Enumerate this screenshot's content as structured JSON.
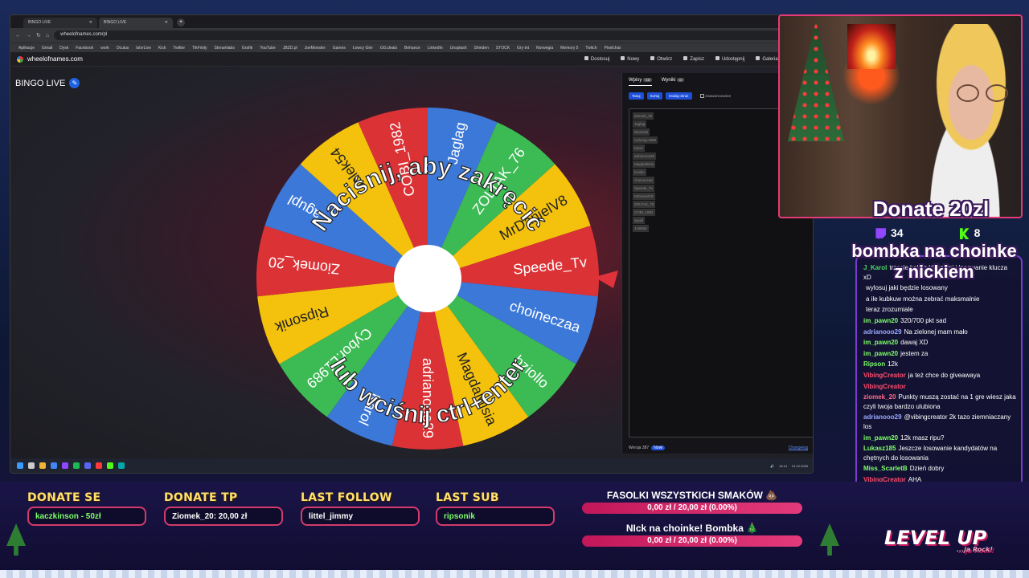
{
  "browser": {
    "tabs": [
      "BINGO LIVE",
      "BINGO LIVE"
    ],
    "url": "wheelofnames.com/pl",
    "bookmarks": [
      "Aplikacje",
      "Gmail",
      "Dysk",
      "Facebook",
      "work",
      "Oculus",
      "tstvrLive",
      "Kick",
      "Twitter",
      "TikFinity",
      "Streamlabs",
      "Grafik",
      "YouTube",
      "JBZD.pl",
      "JoeMonster",
      "Games",
      "Łowcy Gier",
      "GG.deals",
      "Behance",
      "LinkedIn",
      "Unsplash",
      "Shinden",
      "STOCK",
      "Gry tnt",
      "Norwegia",
      "Memory 5",
      "Twitch",
      "Pixelchat"
    ]
  },
  "app": {
    "site_name": "wheelofnames.com",
    "menu": [
      "Dostosuj",
      "Nowy",
      "Otwórz",
      "Zapisz",
      "Udostępnij",
      "Galeria",
      "Więc"
    ],
    "wheel_title": "BINGO LIVE",
    "pen_icon": "pencil-icon"
  },
  "wheel": {
    "segments": [
      {
        "label": "COBI_1982",
        "color": "#db3236"
      },
      {
        "label": "Jaglag",
        "color": "#3c78d8"
      },
      {
        "label": "ZOLTAK_76",
        "color": "#3cba54"
      },
      {
        "label": "MrDanielV8",
        "color": "#f4c20d"
      },
      {
        "label": "Speede_Tv",
        "color": "#db3236"
      },
      {
        "label": "choineczaa",
        "color": "#3c78d8"
      },
      {
        "label": "bziollo",
        "color": "#3cba54"
      },
      {
        "label": "MagdaMisia",
        "color": "#f4c20d"
      },
      {
        "label": "adrianooo29",
        "color": "#db3236"
      },
      {
        "label": "Karol",
        "color": "#3c78d8"
      },
      {
        "label": "Cybor.L1989",
        "color": "#3cba54"
      },
      {
        "label": "Ripsonik",
        "color": "#f4c20d"
      },
      {
        "label": "Ziomek_20",
        "color": "#db3236"
      },
      {
        "label": "agupl",
        "color": "#3c78d8"
      },
      {
        "label": "Jolek54",
        "color": "#f4c20d"
      }
    ],
    "overlay_top": "Naciśnij, aby zakręcić",
    "overlay_bottom": "lub wciśnij ctrl+enter"
  },
  "side": {
    "tab_entries": "Wpisy",
    "tab_entries_count": "15",
    "tab_results": "Wyniki",
    "tab_results_count": "0",
    "btn_shuffle": "Tasuj",
    "btn_sort": "Sortuj",
    "btn_add_image": "Dodaj obraz",
    "advanced": "Zaawansowane",
    "entries": [
      "Ziomek_20",
      "Jaglag",
      "Ripsonik",
      "CyborgL1989",
      "Karol",
      "adrianooo29",
      "MagdaMisia",
      "bziollo",
      "choineczaa",
      "Speede_Tv",
      "MrDanielV8",
      "ZOLTAK_76",
      "COBI_1982",
      "agupl",
      "Jolek54"
    ],
    "version": "Wersja 387",
    "new_badge": "Nowi",
    "changelog": "Changelog"
  },
  "tray": {
    "time": "13:14",
    "date": "21.12.2025"
  },
  "stream": {
    "twitch_count": "34",
    "kick_count": "8",
    "donate_caption": "Donate 20zl",
    "bombka_caption": "bombka na choinke z nickiem",
    "chat": [
      {
        "user": "J_Karol",
        "color": "#4cd964",
        "text": "trzecie koło z kluczami i losowanie klucza xD"
      },
      {
        "user": "",
        "color": "#4cd964",
        "text": "wylosuj jaki będzie losowany"
      },
      {
        "user": "",
        "color": "#5a8cff",
        "text": "a ile kubkuw można zebrać maksmalnie"
      },
      {
        "user": "",
        "color": "#5a8cff",
        "text": "teraz zrozumiale"
      },
      {
        "user": "im_pawn20",
        "color": "#7dff6b",
        "text": "320/700 pkt sad"
      },
      {
        "user": "adrianooo29",
        "color": "#9aa8ff",
        "text": "Na zielonej mam mało"
      },
      {
        "user": "im_pawn20",
        "color": "#7dff6b",
        "text": "dawaj XD"
      },
      {
        "user": "im_pawn20",
        "color": "#7dff6b",
        "text": "jestem za"
      },
      {
        "user": "Ripson",
        "color": "#7dff6b",
        "text": "12k"
      },
      {
        "user": "VibingCreator",
        "color": "#ff4d6d",
        "text": "ja też chce do giveawaya"
      },
      {
        "user": "VibingCreator",
        "color": "#ff4d6d",
        "text": ""
      },
      {
        "user": "ziomek_20",
        "color": "#ff6b8b",
        "text": "Punkty muszą zostać na 1 gre wiesz jaka czyli twoja bardzo ulubiona"
      },
      {
        "user": "adrianooo29",
        "color": "#9aa8ff",
        "text": "@vibingcreator 2k tazo ziemniaczany los"
      },
      {
        "user": "im_pawn20",
        "color": "#7dff6b",
        "text": "12k masz ripu?"
      },
      {
        "user": "Lukasz185",
        "color": "#7dff6b",
        "text": "Jeszcze losowanie kandydatów na chętnych do losowania"
      },
      {
        "user": "Miss_ScarletB",
        "color": "#7dff6b",
        "text": "Dzień dobry"
      },
      {
        "user": "VibingCreator",
        "color": "#ff4d6d",
        "text": "AHA"
      }
    ],
    "widgets": [
      {
        "label": "DONATE SE",
        "value": "kaczkinson - 50zł"
      },
      {
        "label": "DONATE TP",
        "value": "Ziomek_20: 20,00 zł"
      },
      {
        "label": "LAST FOLLOW",
        "value": "littel_jimmy"
      },
      {
        "label": "LAST SUB",
        "value": "ripsonik"
      }
    ],
    "goals": [
      {
        "title": "FASOLKI WSZYSTKICH SMAKÓW 💩",
        "progress": "0,00 zł / 20,00 zł (0.00%)"
      },
      {
        "title": "NIck na choinke! Bombka 🎄",
        "progress": "0,00 zł / 20,00 zł (0.00%)"
      }
    ],
    "logo_text": "LEVEL UP",
    "logo_sub": "...ja Rock!"
  }
}
